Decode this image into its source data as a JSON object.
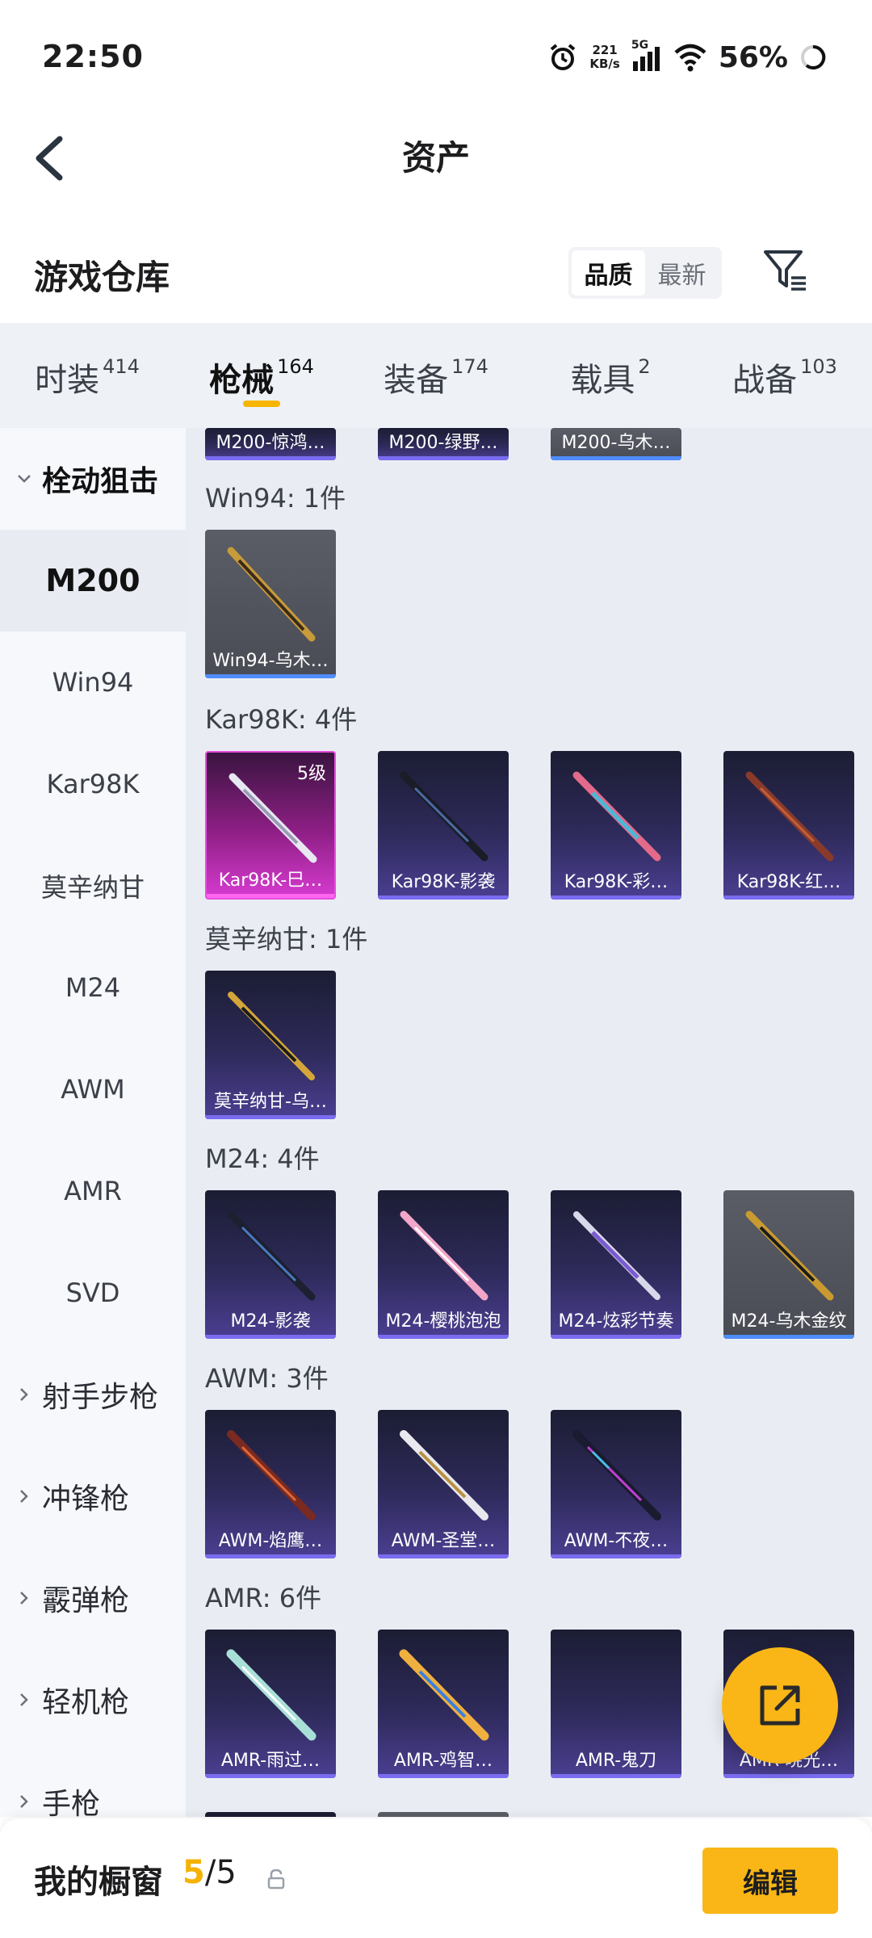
{
  "status_bar": {
    "time": "22:50",
    "net_speed_value": "221",
    "net_speed_unit": "KB/s",
    "network_type": "5G",
    "battery": "56%"
  },
  "header": {
    "title": "资产"
  },
  "warehouse": {
    "title": "游戏仓库",
    "sort_options": [
      "品质",
      "最新"
    ],
    "sort_selected": "品质"
  },
  "tabs": [
    {
      "label": "时装",
      "count": "414"
    },
    {
      "label": "枪械",
      "count": "164",
      "active": true
    },
    {
      "label": "装备",
      "count": "174"
    },
    {
      "label": "载具",
      "count": "2"
    },
    {
      "label": "战备",
      "count": "103"
    }
  ],
  "sidebar": {
    "open_category": "栓动狙击",
    "items": [
      "M200",
      "Win94",
      "Kar98K",
      "莫辛纳甘",
      "M24",
      "AWM",
      "AMR",
      "SVD"
    ],
    "active_item": "M200",
    "collapsed_categories": [
      "射手步枪",
      "冲锋枪",
      "霰弹枪",
      "轻机枪",
      "手枪"
    ]
  },
  "content": {
    "top_cards": [
      {
        "label": "M200-惊鸿…",
        "color": "purple"
      },
      {
        "label": "M200-绿野…",
        "color": "purple"
      },
      {
        "label": "M200-乌木…",
        "color": "gray"
      }
    ],
    "sections": [
      {
        "title": "Win94: 1件",
        "cards": [
          {
            "label": "Win94-乌木…",
            "color": "gray"
          }
        ]
      },
      {
        "title": "Kar98K: 4件",
        "cards": [
          {
            "label": "Kar98K-巳…",
            "color": "pink",
            "level": "5级"
          },
          {
            "label": "Kar98K-影袭",
            "color": "purple"
          },
          {
            "label": "Kar98K-彩…",
            "color": "purple"
          },
          {
            "label": "Kar98K-红…",
            "color": "purple"
          }
        ]
      },
      {
        "title": "莫辛纳甘: 1件",
        "cards": [
          {
            "label": "莫辛纳甘-乌…",
            "color": "purple"
          }
        ]
      },
      {
        "title": "M24: 4件",
        "cards": [
          {
            "label": "M24-影袭",
            "color": "purple"
          },
          {
            "label": "M24-樱桃泡泡",
            "color": "purple"
          },
          {
            "label": "M24-炫彩节奏",
            "color": "purple"
          },
          {
            "label": "M24-乌木金纹",
            "color": "gray"
          }
        ]
      },
      {
        "title": "AWM: 3件",
        "cards": [
          {
            "label": "AWM-焰鹰…",
            "color": "purple"
          },
          {
            "label": "AWM-圣堂…",
            "color": "purple"
          },
          {
            "label": "AWM-不夜…",
            "color": "purple"
          }
        ]
      },
      {
        "title": "AMR: 6件",
        "cards": [
          {
            "label": "AMR-雨过…",
            "color": "purple"
          },
          {
            "label": "AMR-鸡智…",
            "color": "purple"
          },
          {
            "label": "AMR-鬼刀",
            "color": "purple"
          },
          {
            "label": "AMR-晓光…",
            "color": "purple"
          }
        ]
      }
    ]
  },
  "bottom_bar": {
    "title": "我的橱窗",
    "count_current": "5",
    "count_total": "/5",
    "edit_label": "编辑"
  },
  "icons": {
    "back": "chevron-left-icon",
    "filter": "filter-icon",
    "share": "share-external-icon",
    "lock": "lock-icon"
  },
  "colors": {
    "accent": "#f9b616",
    "tab_bg": "#eef2f7",
    "content_bg": "#e9edf3",
    "card_purple": "#4b3f92",
    "card_gray": "#4a4c55",
    "card_pink": "#d73bd0"
  }
}
